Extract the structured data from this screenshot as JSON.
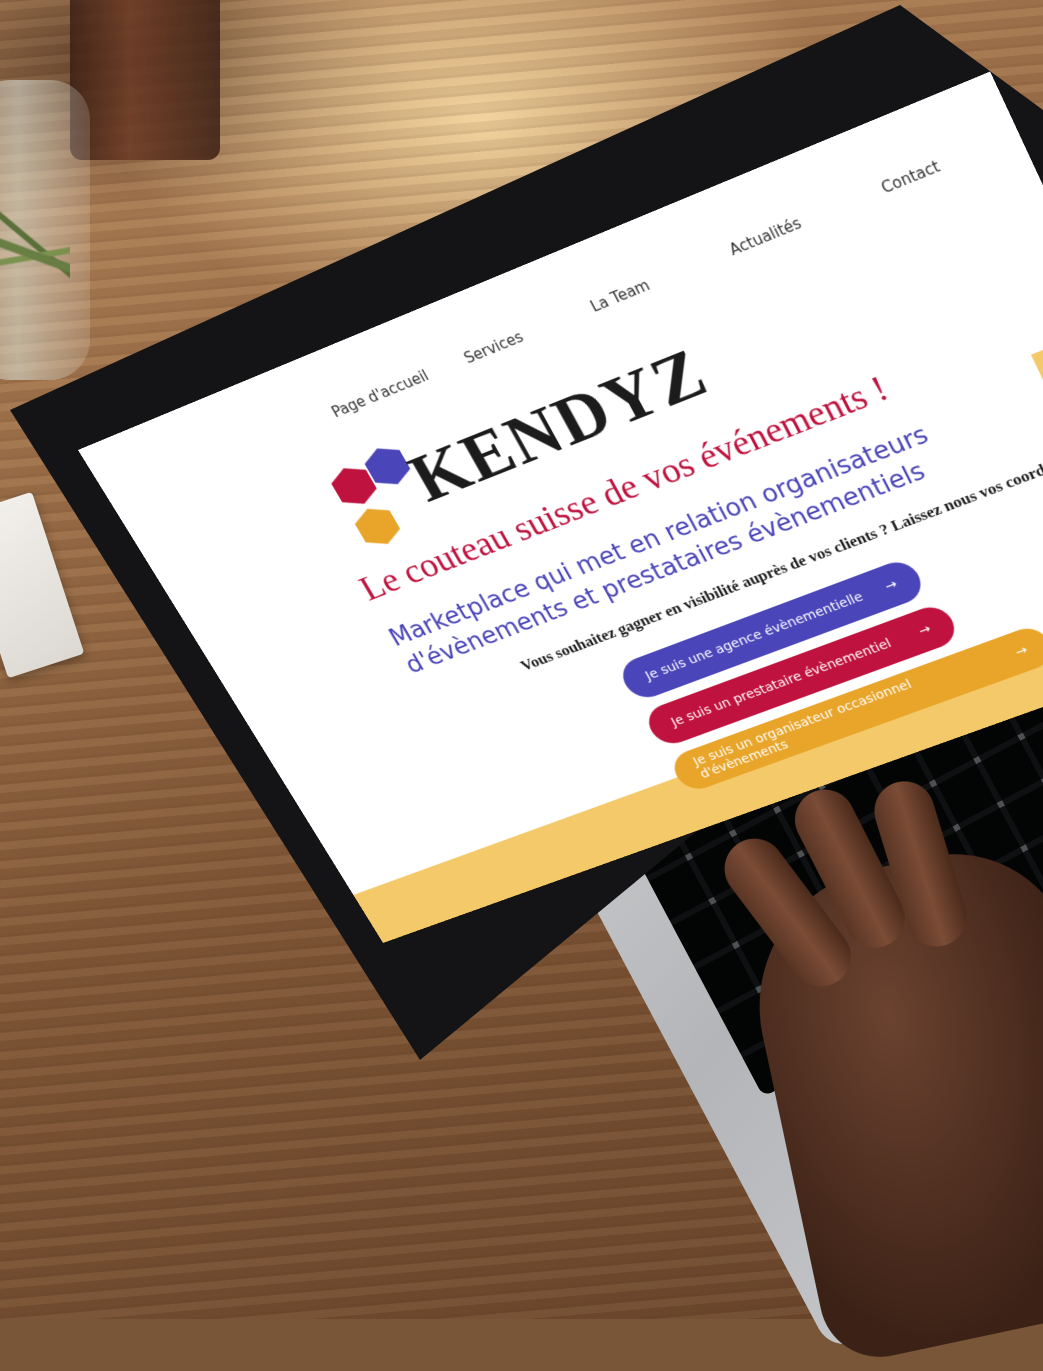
{
  "colors": {
    "brand_red": "#c0123e",
    "brand_purple": "#4a45b9",
    "brand_orange": "#e8a52a",
    "band_yellow": "#f4c96a"
  },
  "site": {
    "nav": [
      "Page d'accueil",
      "Services",
      "La Team",
      "Actualités",
      "Contact"
    ],
    "brand": "KENDYZ",
    "tagline": "Le couteau suisse de vos événements !",
    "subline": "Marketplace qui met en relation organisateurs d'évènements et prestataires évènementiels",
    "pitch": "Vous souhaitez gagner en visibilité auprès de vos clients ? Laissez nous vos coordonnées !",
    "buttons": [
      {
        "label": "Je suis une agence évènementielle",
        "arrow": "→",
        "color": "#4a45b9"
      },
      {
        "label": "Je suis un prestataire évènementiel",
        "arrow": "→",
        "color": "#c0123e"
      },
      {
        "label": "Je suis un organisateur occasionnel d'évènements",
        "arrow": "→",
        "color": "#e8a52a"
      }
    ]
  }
}
